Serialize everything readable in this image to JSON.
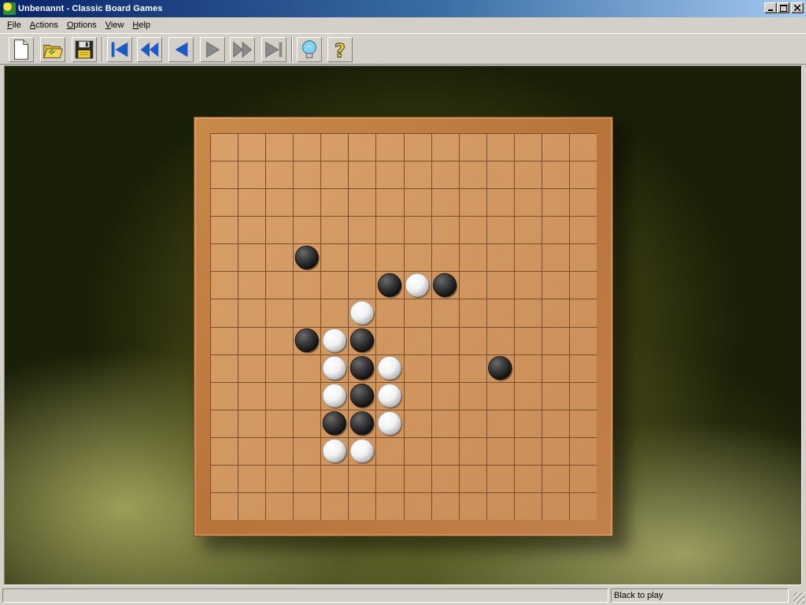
{
  "window": {
    "title": "Unbenannt - Classic Board Games",
    "controls": [
      "minimize",
      "maximize",
      "close"
    ]
  },
  "menu": [
    {
      "label": "File",
      "underline": "F",
      "rest": "ile"
    },
    {
      "label": "Actions",
      "underline": "A",
      "rest": "ctions"
    },
    {
      "label": "Options",
      "underline": "O",
      "rest": "ptions"
    },
    {
      "label": "View",
      "underline": "V",
      "rest": "iew"
    },
    {
      "label": "Help",
      "underline": "H",
      "rest": "elp"
    }
  ],
  "toolbar": [
    {
      "name": "new-game-button",
      "icon": "new-document-icon"
    },
    {
      "name": "open-button",
      "icon": "open-folder-icon"
    },
    {
      "name": "save-button",
      "icon": "floppy-disk-icon"
    },
    {
      "name": "first-move-button",
      "icon": "skip-to-start-icon"
    },
    {
      "name": "fast-back-button",
      "icon": "fast-backward-icon"
    },
    {
      "name": "back-button",
      "icon": "step-backward-icon"
    },
    {
      "name": "forward-button",
      "icon": "step-forward-icon"
    },
    {
      "name": "fast-forward-button",
      "icon": "fast-forward-icon"
    },
    {
      "name": "last-move-button",
      "icon": "skip-to-end-icon"
    },
    {
      "name": "hint-button",
      "icon": "lightbulb-icon"
    },
    {
      "name": "help-button",
      "icon": "question-mark-icon"
    }
  ],
  "board": {
    "cells": 14,
    "colors": {
      "black": "#3a3a3a",
      "white": "#f2f2f2"
    },
    "stones": [
      {
        "col": 3,
        "row": 4,
        "color": "black"
      },
      {
        "col": 6,
        "row": 5,
        "color": "black"
      },
      {
        "col": 7,
        "row": 5,
        "color": "white"
      },
      {
        "col": 8,
        "row": 5,
        "color": "black"
      },
      {
        "col": 5,
        "row": 6,
        "color": "white"
      },
      {
        "col": 3,
        "row": 7,
        "color": "black"
      },
      {
        "col": 4,
        "row": 7,
        "color": "white"
      },
      {
        "col": 5,
        "row": 7,
        "color": "black"
      },
      {
        "col": 4,
        "row": 8,
        "color": "white"
      },
      {
        "col": 5,
        "row": 8,
        "color": "black"
      },
      {
        "col": 6,
        "row": 8,
        "color": "white"
      },
      {
        "col": 10,
        "row": 8,
        "color": "black"
      },
      {
        "col": 4,
        "row": 9,
        "color": "white"
      },
      {
        "col": 5,
        "row": 9,
        "color": "black"
      },
      {
        "col": 6,
        "row": 9,
        "color": "white"
      },
      {
        "col": 4,
        "row": 10,
        "color": "black"
      },
      {
        "col": 5,
        "row": 10,
        "color": "black"
      },
      {
        "col": 6,
        "row": 10,
        "color": "white"
      },
      {
        "col": 4,
        "row": 11,
        "color": "white"
      },
      {
        "col": 5,
        "row": 11,
        "color": "white"
      }
    ]
  },
  "status": {
    "message": "Black to play"
  }
}
